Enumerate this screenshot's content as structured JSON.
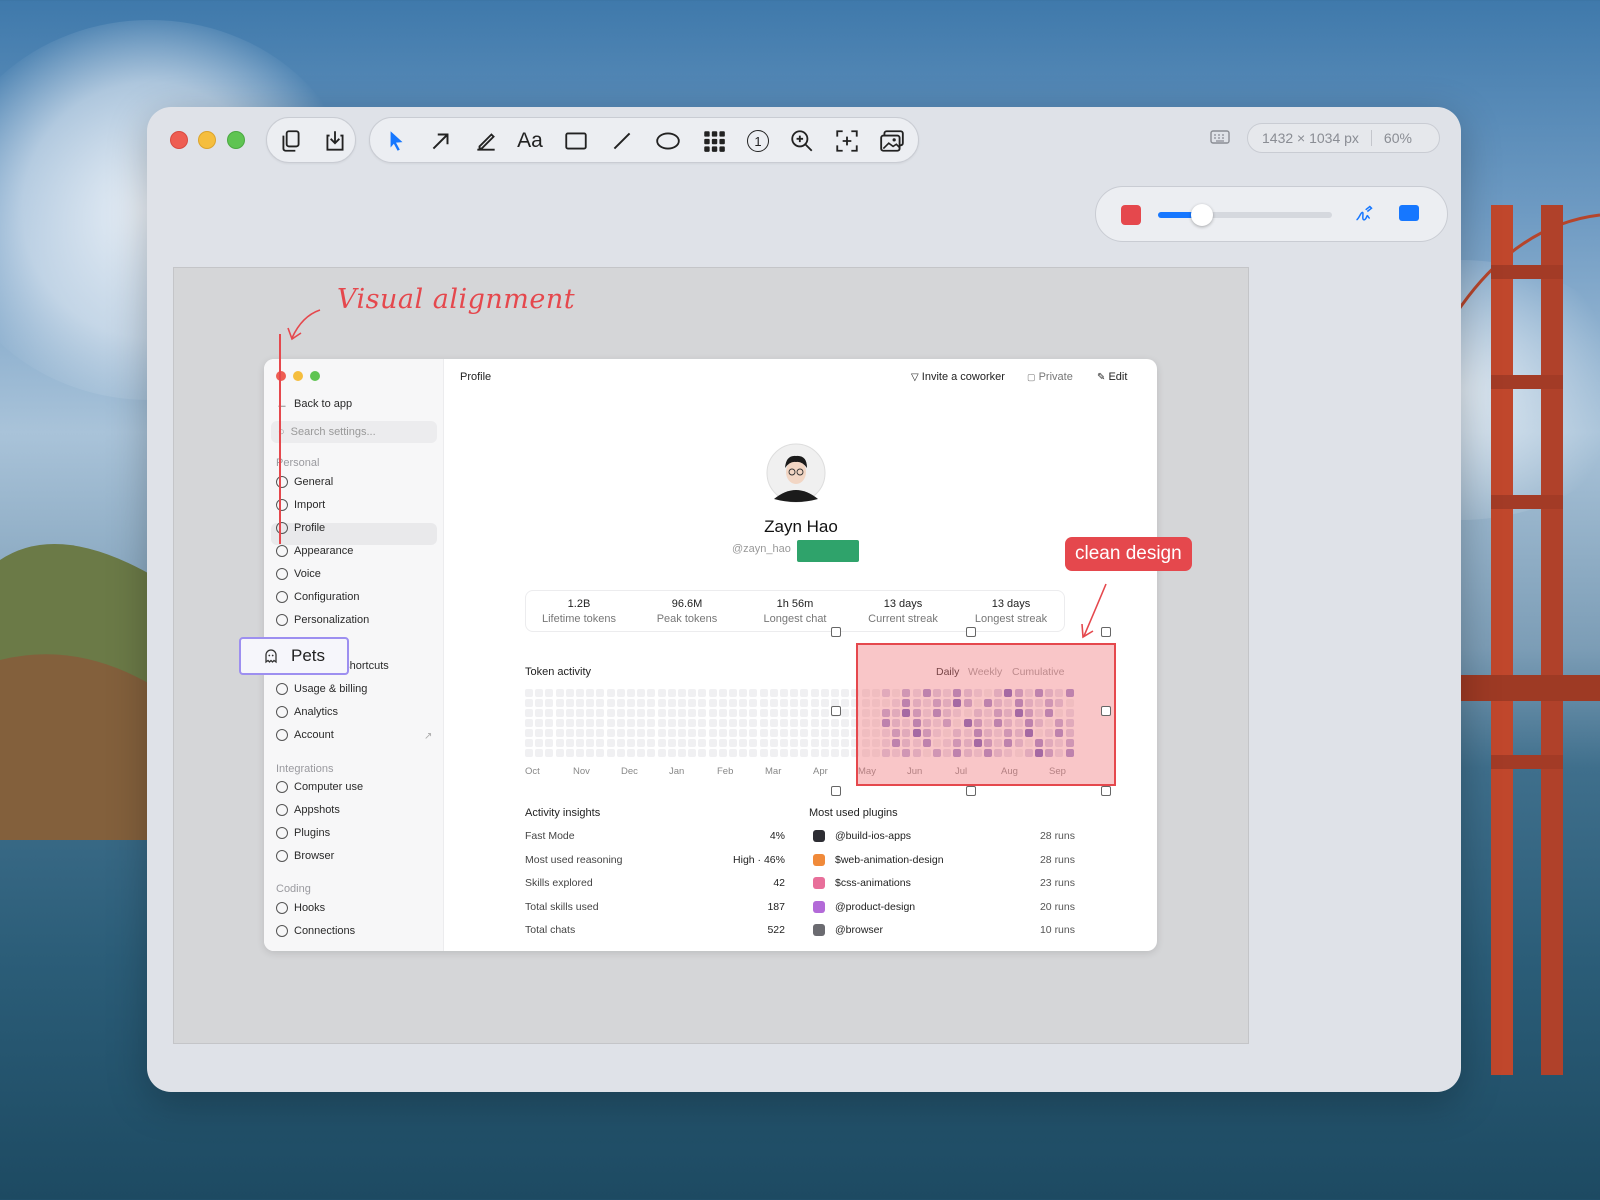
{
  "toolbar": {
    "tools": [
      "copy-icon",
      "download-icon",
      "pointer-icon",
      "arrow-icon",
      "pen-icon",
      "text-icon",
      "rectangle-icon",
      "line-icon",
      "ellipse-icon",
      "grid-icon",
      "number-icon",
      "zoom-icon",
      "crop-icon",
      "image-icon"
    ],
    "text_tool_label": "Aa",
    "number_tool_label": "1",
    "size_label": "1432 × 1034 px",
    "zoom_label": "60%"
  },
  "style_panel": {
    "color": "#e5484d",
    "secondary_color": "#1677ff",
    "stroke_level": 0.25
  },
  "annotations": {
    "visual_alignment": "Visual alignment",
    "clean_design": "clean design",
    "pets": "Pets"
  },
  "sidebar": {
    "back": "Back to app",
    "search_placeholder": "Search settings...",
    "sections": [
      {
        "title": "Personal",
        "items": [
          "General",
          "Import",
          "Profile",
          "Appearance",
          "Voice",
          "Configuration",
          "Personalization",
          "Pets",
          "Keyboard shortcuts",
          "Usage & billing",
          "Analytics",
          "Account"
        ]
      },
      {
        "title": "Integrations",
        "items": [
          "Computer use",
          "Appshots",
          "Plugins",
          "Browser"
        ]
      },
      {
        "title": "Coding",
        "items": [
          "Hooks",
          "Connections"
        ]
      }
    ]
  },
  "header": {
    "title": "Profile",
    "invite": "Invite a coworker",
    "private": "Private",
    "edit": "Edit"
  },
  "profile": {
    "name": "Zayn Hao",
    "handle": "@zayn_hao"
  },
  "stats": [
    {
      "value": "1.2B",
      "label": "Lifetime tokens"
    },
    {
      "value": "96.6M",
      "label": "Peak tokens"
    },
    {
      "value": "1h 56m",
      "label": "Longest chat"
    },
    {
      "value": "13 days",
      "label": "Current streak"
    },
    {
      "value": "13 days",
      "label": "Longest streak"
    }
  ],
  "token_activity": {
    "title": "Token activity",
    "tabs": [
      "Daily",
      "Weekly",
      "Cumulative"
    ],
    "months": [
      "Oct",
      "Nov",
      "Dec",
      "Jan",
      "Feb",
      "Mar",
      "Apr",
      "May",
      "Jun",
      "Jul",
      "Aug",
      "Sep"
    ]
  },
  "insights": {
    "title": "Activity insights",
    "rows": [
      {
        "label": "Fast Mode",
        "value": "4%"
      },
      {
        "label": "Most used reasoning",
        "value": "High · 46%"
      },
      {
        "label": "Skills explored",
        "value": "42"
      },
      {
        "label": "Total skills used",
        "value": "187"
      },
      {
        "label": "Total chats",
        "value": "522"
      }
    ]
  },
  "plugins": {
    "title": "Most used plugins",
    "rows": [
      {
        "name": "@build-ios-apps",
        "runs": "28 runs",
        "color": "#2d2d33"
      },
      {
        "name": "$web-animation-design",
        "runs": "28 runs",
        "color": "#f08a3a"
      },
      {
        "name": "$css-animations",
        "runs": "23 runs",
        "color": "#e86f9a"
      },
      {
        "name": "@product-design",
        "runs": "20 runs",
        "color": "#b36ad8"
      },
      {
        "name": "@browser",
        "runs": "10 runs",
        "color": "#6b6b70"
      }
    ]
  }
}
